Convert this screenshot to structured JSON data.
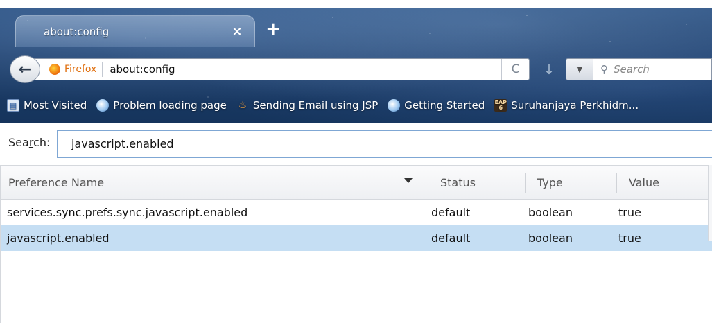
{
  "tab": {
    "title": "about:config",
    "close": "×",
    "new": "+"
  },
  "nav": {
    "back": "←",
    "identity": "Firefox",
    "url": "about:config",
    "reload": "C",
    "download": "↓",
    "engine_dropdown": "▼",
    "search_icon": "⚲",
    "search_placeholder": "Search"
  },
  "bookmarks": [
    {
      "label": "Most Visited",
      "icon": "most-visited-icon"
    },
    {
      "label": "Problem loading page",
      "icon": "globe-icon"
    },
    {
      "label": "Sending Email using JSP",
      "icon": "java-icon"
    },
    {
      "label": "Getting Started",
      "icon": "globe-icon"
    },
    {
      "label": "Suruhanjaya Perkhidm...",
      "icon": "eap-icon"
    }
  ],
  "config": {
    "search_label_before": "Sea",
    "search_label_key": "r",
    "search_label_after": "ch:",
    "search_value": "javascript.enabled",
    "columns": {
      "name": "Preference Name",
      "status": "Status",
      "type": "Type",
      "value": "Value"
    },
    "rows": [
      {
        "name": "services.sync.prefs.sync.javascript.enabled",
        "status": "default",
        "type": "boolean",
        "value": "true"
      },
      {
        "name": "javascript.enabled",
        "status": "default",
        "type": "boolean",
        "value": "true"
      }
    ]
  }
}
